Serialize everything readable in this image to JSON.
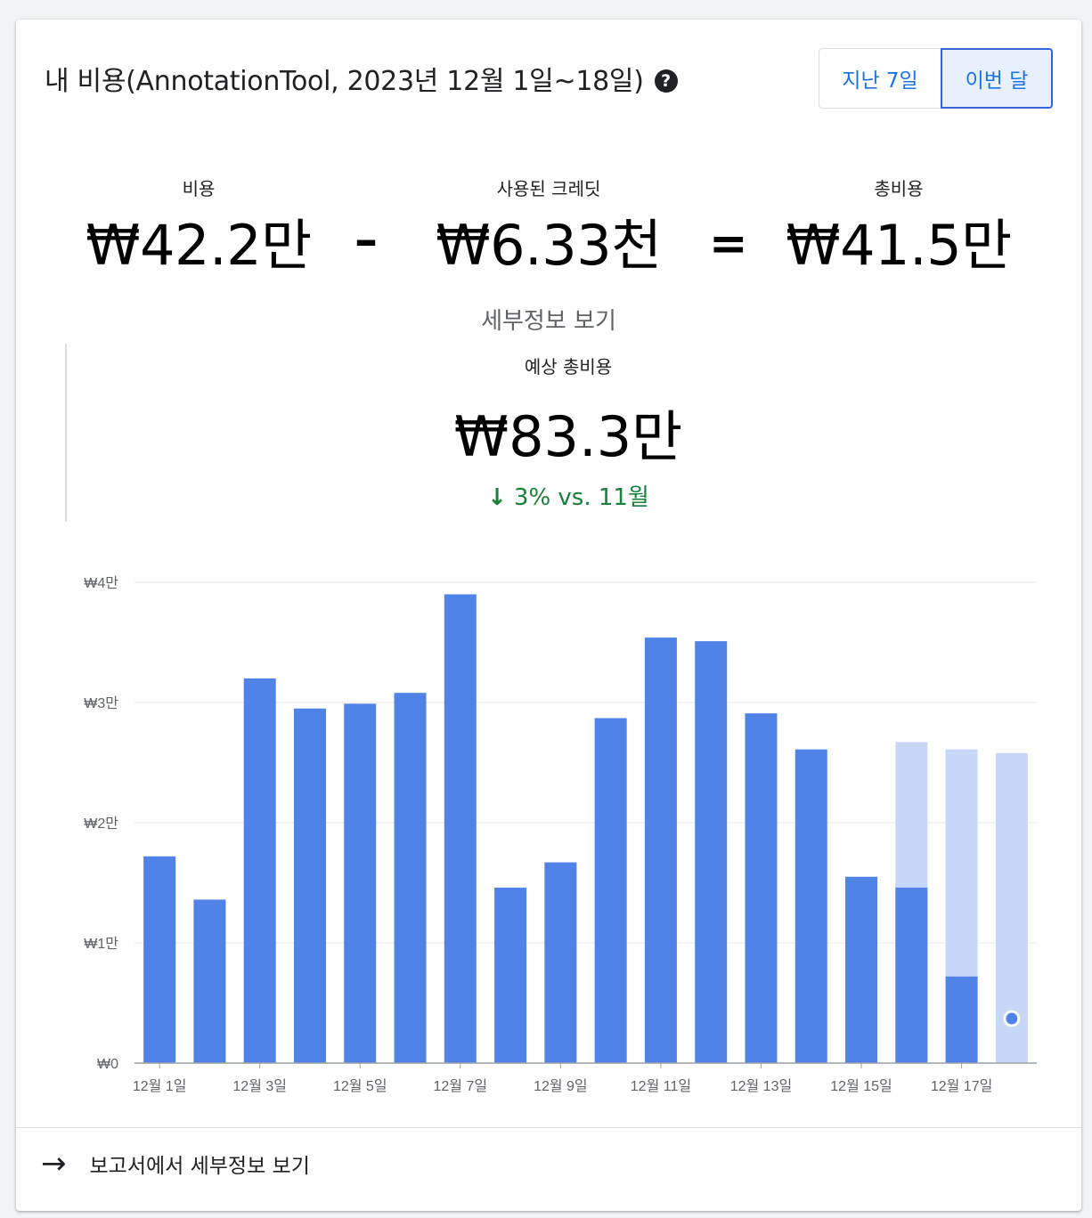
{
  "header": {
    "title": "내 비용(AnnotationTool, 2023년 12월 1일~18일)",
    "help_icon": "?",
    "toggle": [
      {
        "label": "지난 7일",
        "active": false
      },
      {
        "label": "이번 달",
        "active": true
      }
    ]
  },
  "summary": {
    "cost": {
      "label": "비용",
      "value": "₩42.2만"
    },
    "minus": "–",
    "credits": {
      "label": "사용된 크레딧",
      "value": "₩6.33천"
    },
    "equals": "=",
    "total": {
      "label": "총비용",
      "value": "₩41.5만"
    },
    "details_link": "세부정보 보기"
  },
  "forecast": {
    "label": "예상 총비용",
    "value": "₩83.3만",
    "trend": "3% vs. 11월",
    "trend_icon": "arrow-down-icon",
    "trend_color": "#188038"
  },
  "chart_data": {
    "type": "bar",
    "x_tick_labels": [
      "12월 1일",
      "12월 3일",
      "12월 5일",
      "12월 7일",
      "12월 9일",
      "12월 11일",
      "12월 13일",
      "12월 15일",
      "12월 17일"
    ],
    "y_tick_labels": [
      "₩0",
      "₩1만",
      "₩2만",
      "₩3만",
      "₩4만"
    ],
    "ylim": [
      0,
      40000
    ],
    "series": [
      {
        "values": [
          17200,
          13600,
          32000,
          29500,
          29900,
          30800,
          39000,
          14600,
          16700,
          28700,
          35400,
          35100,
          29100,
          26100,
          15500,
          14600,
          7200,
          0
        ],
        "color": "#5083e8"
      },
      {
        "values": [
          0,
          0,
          0,
          0,
          0,
          0,
          0,
          0,
          0,
          0,
          0,
          0,
          0,
          0,
          0,
          26700,
          26100,
          25800
        ],
        "color": "#c6d7f7"
      }
    ],
    "marker": {
      "day_index": 17,
      "value": 3700,
      "color": "#5083e8"
    },
    "grid": true,
    "accent_color": "#5083e8",
    "forecast_color": "#c6d7f7"
  },
  "footer": {
    "link": "보고서에서 세부정보 보기",
    "icon": "arrow-right-icon"
  }
}
